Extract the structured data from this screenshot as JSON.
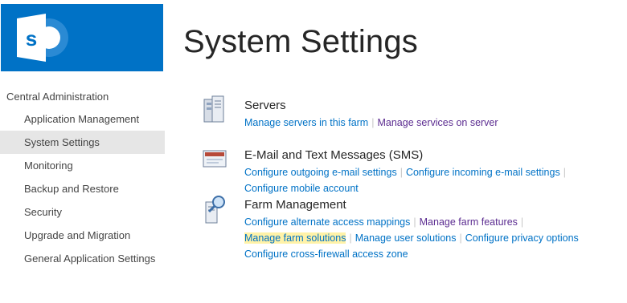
{
  "logo": {
    "name": "sharepoint-logo",
    "letter": "s",
    "bg": "#0072c6"
  },
  "page_title": "System Settings",
  "nav": {
    "root": "Central Administration",
    "items": [
      {
        "label": "Application Management",
        "selected": false
      },
      {
        "label": "System Settings",
        "selected": true
      },
      {
        "label": "Monitoring",
        "selected": false
      },
      {
        "label": "Backup and Restore",
        "selected": false
      },
      {
        "label": "Security",
        "selected": false
      },
      {
        "label": "Upgrade and Migration",
        "selected": false
      },
      {
        "label": "General Application Settings",
        "selected": false
      }
    ]
  },
  "groups": [
    {
      "title": "Servers",
      "icon": "servers-icon",
      "links": [
        [
          "Manage servers in this farm",
          "Manage services on server"
        ]
      ]
    },
    {
      "title": "E-Mail and Text Messages (SMS)",
      "icon": "email-icon",
      "links": [
        [
          "Configure outgoing e-mail settings",
          "Configure incoming e-mail settings"
        ],
        [
          "Configure mobile account"
        ]
      ]
    },
    {
      "title": "Farm Management",
      "icon": "farm-management-icon",
      "links": [
        [
          "Configure alternate access mappings",
          "Manage farm features"
        ],
        [
          "Manage farm solutions",
          "Manage user solutions",
          "Configure privacy options"
        ],
        [
          "Configure cross-firewall access zone"
        ]
      ]
    }
  ],
  "colors": {
    "link": "#0072c6",
    "visited_link": "#5c2d91",
    "highlight": "#fff2a8",
    "nav_selected": "#e6e6e6"
  }
}
